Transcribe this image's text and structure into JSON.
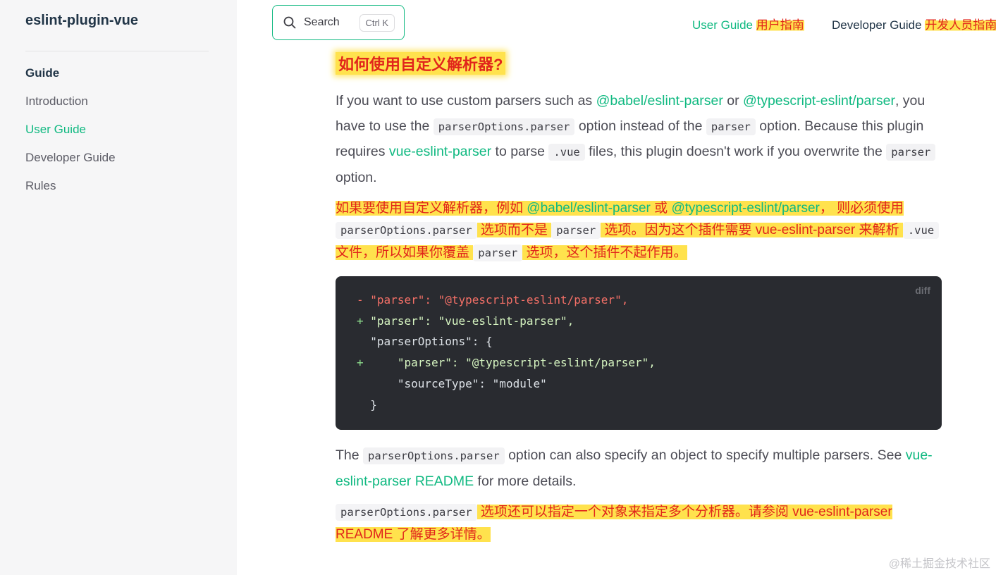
{
  "sidebar": {
    "title": "eslint-plugin-vue",
    "section": "Guide",
    "items": [
      {
        "label": "Introduction"
      },
      {
        "label": "User Guide"
      },
      {
        "label": "Developer Guide"
      },
      {
        "label": "Rules"
      }
    ]
  },
  "search": {
    "label": "Search",
    "shortcut": "Ctrl K"
  },
  "nav": {
    "user_guide": "User Guide",
    "user_guide_zh": "用户指南",
    "developer_guide": "Developer Guide",
    "developer_guide_zh": "开发人员指南"
  },
  "main": {
    "heading": "如何使用自定义解析器?",
    "p1": {
      "t1": "If you want to use custom parsers such as ",
      "link1": "@babel/eslint-parser",
      "t2": " or ",
      "link2": "@typescript-eslint/parser",
      "t3": ", you have to use the ",
      "code1": "parserOptions.parser",
      "t4": " option instead of the ",
      "code2": "parser",
      "t5": " option. Because this plugin requires ",
      "link3": "vue-eslint-parser",
      "t6": " to parse ",
      "code3": ".vue",
      "t7": " files, this plugin doesn't work if you overwrite the ",
      "code4": "parser",
      "t8": " option."
    },
    "zh1": {
      "t1": "如果要使用自定义解析器，例如 ",
      "link1": "@babel/eslint-parser",
      "t2": " 或 ",
      "link2": "@typescript-eslint/parser",
      "t3": "， 则必须使用 ",
      "code1": "parserOptions.parser",
      "t4": " 选项而不是 ",
      "code2": "parser",
      "t5": " 选项。因为这个插件需要 vue-eslint-parser 来解析 ",
      "code3": ".vue",
      "t6": " 文件，所以如果你覆盖 ",
      "code4": "parser",
      "t7": " 选项，这个插件不起作用。"
    },
    "code_block": {
      "lang": "diff",
      "lines": [
        {
          "mark": "-",
          "text": "\"parser\": \"@typescript-eslint/parser\","
        },
        {
          "mark": "+",
          "text": "\"parser\": \"vue-eslint-parser\","
        },
        {
          "mark": " ",
          "text": "\"parserOptions\": {"
        },
        {
          "mark": "+",
          "text": "    \"parser\": \"@typescript-eslint/parser\","
        },
        {
          "mark": " ",
          "text": "    \"sourceType\": \"module\""
        },
        {
          "mark": " ",
          "text": "}"
        }
      ]
    },
    "p2": {
      "t1": "The ",
      "code1": "parserOptions.parser",
      "t2": " option can also specify an object to specify multiple parsers. See ",
      "link1": "vue-eslint-parser README",
      "t3": " for more details."
    },
    "zh2": {
      "code1": "parserOptions.parser",
      "t1": " 选项还可以指定一个对象来指定多个分析器。请参阅 vue-eslint-parser README 了解更多详情。"
    }
  },
  "watermark": "@稀土掘金技术社区",
  "colors": {
    "accent": "#10b981",
    "highlight": "#ffe24d",
    "translation_text": "#e1251b",
    "code_bg": "#292b30"
  }
}
